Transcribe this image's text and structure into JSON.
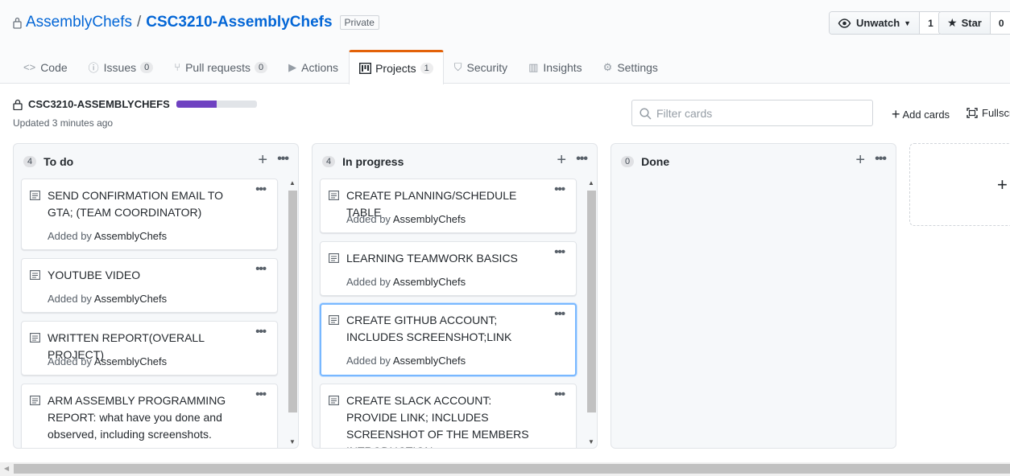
{
  "repo": {
    "owner": "AssemblyChefs",
    "separator": "/",
    "name": "CSC3210-AssemblyChefs",
    "visibility": "Private",
    "watch_label": "Unwatch",
    "watch_count": "1",
    "star_label": "Star",
    "star_count": "0"
  },
  "tabs": [
    {
      "label": "Code",
      "icon": "code-icon",
      "count": null
    },
    {
      "label": "Issues",
      "icon": "issue-icon",
      "count": "0"
    },
    {
      "label": "Pull requests",
      "icon": "pull-request-icon",
      "count": "0"
    },
    {
      "label": "Actions",
      "icon": "play-icon",
      "count": null
    },
    {
      "label": "Projects",
      "icon": "project-icon",
      "count": "1",
      "active": true
    },
    {
      "label": "Security",
      "icon": "shield-icon",
      "count": null
    },
    {
      "label": "Insights",
      "icon": "graph-icon",
      "count": null
    },
    {
      "label": "Settings",
      "icon": "gear-icon",
      "count": null
    }
  ],
  "project": {
    "name": "CSC3210-ASSEMBLYCHEFS",
    "progress_fraction": 0.5,
    "updated": "Updated 3 minutes ago",
    "filter_placeholder": "Filter cards",
    "add_cards": "Add cards",
    "fullscreen": "Fullscreen"
  },
  "card_meta": {
    "added_prefix": "Added by",
    "added_by": "AssemblyChefs"
  },
  "columns": [
    {
      "title": "To do",
      "count": "4",
      "cards": [
        {
          "text": "SEND CONFIRMATION EMAIL TO GTA; (TEAM COORDINATOR)"
        },
        {
          "text": "YOUTUBE VIDEO"
        },
        {
          "text": "WRITTEN REPORT(OVERALL PROJECT)"
        },
        {
          "text": "ARM ASSEMBLY PROGRAMMING REPORT: what have you done and observed, including screenshots."
        }
      ]
    },
    {
      "title": "In progress",
      "count": "4",
      "cards": [
        {
          "text": "CREATE PLANNING/SCHEDULE TABLE"
        },
        {
          "text": "LEARNING TEAMWORK BASICS"
        },
        {
          "text": "CREATE GITHUB ACCOUNT; INCLUDES SCREENSHOT;LINK"
        },
        {
          "text": "CREATE SLACK ACCOUNT: PROVIDE LINK; INCLUDES SCREENSHOT OF THE MEMBERS INTRODUCTION"
        }
      ]
    },
    {
      "title": "Done",
      "count": "0",
      "cards": []
    }
  ],
  "colors": {
    "accent": "#0366d6",
    "tab_active_border": "#e36209",
    "progress_fill": "#6f42c1",
    "selected_card_border": "#79b8ff"
  }
}
